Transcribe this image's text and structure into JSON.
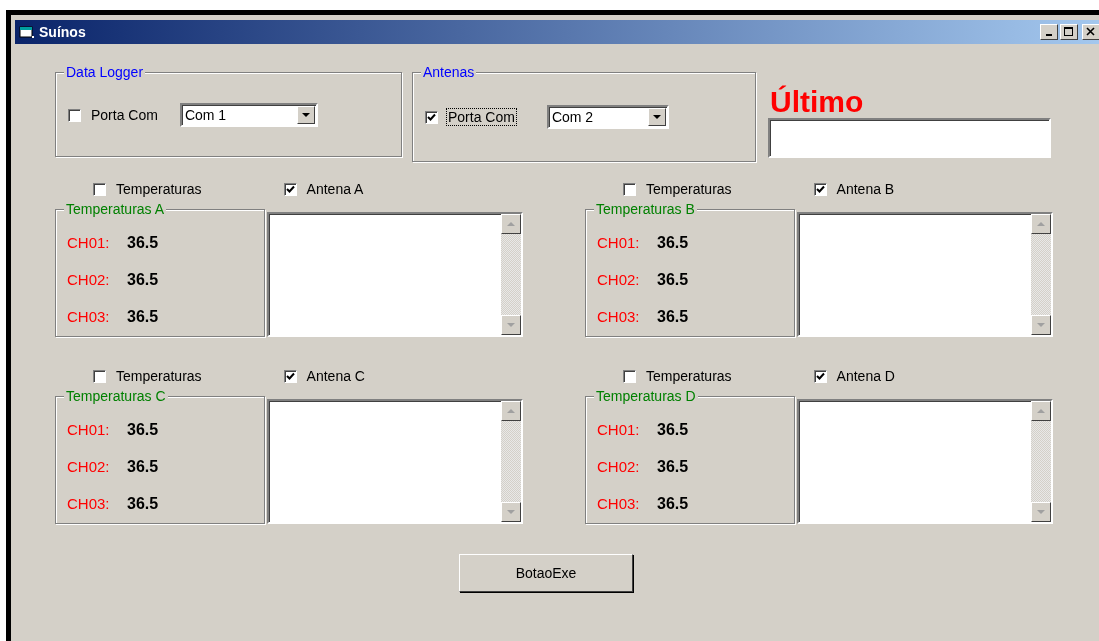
{
  "window": {
    "title": "Suínos"
  },
  "groups": [
    {
      "title": "Data Logger",
      "checkbox": {
        "label": "Porta Com",
        "checked": false,
        "focused": false
      },
      "combo": {
        "value": "Com 1"
      }
    },
    {
      "title": "Antenas",
      "checkbox": {
        "label": "Porta Com",
        "checked": true,
        "focused": true
      },
      "combo": {
        "value": "Com 2"
      }
    }
  ],
  "last_label": "Último",
  "panels": [
    {
      "temperaturas": {
        "label": "Temperaturas",
        "checked": false
      },
      "antena": {
        "label": "Antena A",
        "checked": true
      },
      "group_title": "Temperaturas A",
      "channels": [
        {
          "label": "CH01:",
          "value": "36.5"
        },
        {
          "label": "CH02:",
          "value": "36.5"
        },
        {
          "label": "CH03:",
          "value": "36.5"
        }
      ]
    },
    {
      "temperaturas": {
        "label": "Temperaturas",
        "checked": false
      },
      "antena": {
        "label": "Antena B",
        "checked": true
      },
      "group_title": "Temperaturas B",
      "channels": [
        {
          "label": "CH01:",
          "value": "36.5"
        },
        {
          "label": "CH02:",
          "value": "36.5"
        },
        {
          "label": "CH03:",
          "value": "36.5"
        }
      ]
    },
    {
      "temperaturas": {
        "label": "Temperaturas",
        "checked": false
      },
      "antena": {
        "label": "Antena C",
        "checked": true
      },
      "group_title": "Temperaturas C",
      "channels": [
        {
          "label": "CH01:",
          "value": "36.5"
        },
        {
          "label": "CH02:",
          "value": "36.5"
        },
        {
          "label": "CH03:",
          "value": "36.5"
        }
      ]
    },
    {
      "temperaturas": {
        "label": "Temperaturas",
        "checked": false
      },
      "antena": {
        "label": "Antena D",
        "checked": true
      },
      "group_title": "Temperaturas D",
      "channels": [
        {
          "label": "CH01:",
          "value": "36.5"
        },
        {
          "label": "CH02:",
          "value": "36.5"
        },
        {
          "label": "CH03:",
          "value": "36.5"
        }
      ]
    }
  ],
  "button": "BotaoExe"
}
